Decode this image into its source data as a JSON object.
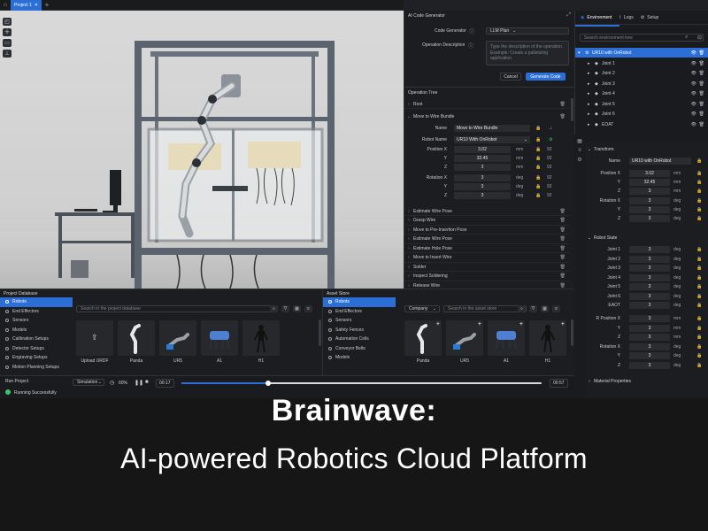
{
  "tabbar": {
    "tab_label": "Project 1",
    "close": "✕",
    "add": "+"
  },
  "ai_code": {
    "title": "AI Code Generator",
    "code_generator_label": "Code Generator",
    "code_generator_value": "LLM Plan",
    "operation_desc_label": "Operation Description",
    "operation_desc_placeholder": "Type the description of the operation. Example: Create a palletizing application",
    "cancel": "Cancel",
    "generate": "Generate Code"
  },
  "op_tree": {
    "title": "Operation Tree",
    "root": "Root",
    "group": "Move to Wire Bundle",
    "fields": {
      "name_label": "Name",
      "name_value": "Move to Wire Bundle",
      "robot_label": "Robot Name",
      "robot_value": "UR10 With OnRobot",
      "px_label": "Position X",
      "px": "3.02",
      "py_label": "Y",
      "py": "32.45",
      "pz_label": "Z",
      "pz": "3",
      "rx_label": "Rotation X",
      "rx": "3",
      "ry_label": "Y",
      "ry": "3",
      "rz_label": "Z",
      "rz": "3",
      "mm": "mm",
      "deg": "deg"
    },
    "ops": [
      "Estimate Wire Pose",
      "Grasp Wire",
      "Move to Pre-Insertion Pose",
      "Estimate Wire Pose",
      "Estimate Hole Pose",
      "Move to Insert Wire",
      "Solder",
      "Inspect Soldering",
      "Release Wire"
    ]
  },
  "env": {
    "tabs": [
      "Environment",
      "Logs",
      "Setup"
    ],
    "search_placeholder": "Search environment tree",
    "root": "UR10 with OnRobot",
    "joints": [
      "Joint 1",
      "Joint 2",
      "Joint 3",
      "Joint 4",
      "Joint 5",
      "Joint 6",
      "EOAT"
    ]
  },
  "props": {
    "transform": "Transform",
    "name_label": "Name",
    "name_value": "UR10 with OnRobot",
    "px_label": "Position X",
    "px": "3.02",
    "py_label": "Y",
    "py": "32.45",
    "pz_label": "Z",
    "pz": "3",
    "rx_label": "Rotation X",
    "rx": "3",
    "ry_label": "Y",
    "ry": "3",
    "rz_label": "Z",
    "rz": "3",
    "robot_state": "Robot State",
    "joint_labels": [
      "Joint 1",
      "Joint 2",
      "Joint 3",
      "Joint 4",
      "Joint 5",
      "Joint 6",
      "EAOT"
    ],
    "joint_values": [
      "3",
      "3",
      "3",
      "3",
      "3",
      "3",
      "3"
    ],
    "r_pos_label": "R Position X",
    "r_px": "3",
    "r_py_label": "Y",
    "r_py": "3",
    "r_pz_label": "Z",
    "r_pz": "3",
    "r_rx_label": "Rotation X",
    "r_rx": "3",
    "r_ry_label": "Y",
    "r_ry": "3",
    "r_rz_label": "Z",
    "r_rz": "3",
    "material": "Material Properties",
    "mm": "mm",
    "deg": "deg"
  },
  "project_db": {
    "title": "Project Database",
    "items": [
      "Robots",
      "End Effectors",
      "Sensors",
      "Models",
      "Calibration Setups",
      "Detector Setups",
      "Engraving Setups",
      "Motion Planning Setups"
    ],
    "search_placeholder": "Search in the project database",
    "cards": [
      "Upload URDF",
      "Panda",
      "UR5",
      "A1",
      "H1"
    ]
  },
  "asset_store": {
    "title": "Asset Store",
    "items": [
      "Robots",
      "End Effectors",
      "Sensors",
      "Safety Fences",
      "Automation Cells",
      "Conveyor Belts",
      "Models"
    ],
    "company": "Company",
    "search_placeholder": "Search in the asset store",
    "cards": [
      "Panda",
      "UR5",
      "A1",
      "H1"
    ]
  },
  "run": {
    "title": "Run Project",
    "mode": "Simulation",
    "speed": "60%",
    "elapsed": "00:17",
    "total": "00:57",
    "progress": 0.24,
    "status": "Running Successfully"
  },
  "caption": {
    "title": "Brainwave:",
    "subtitle": "AI-powered Robotics Cloud Platform"
  },
  "colors": {
    "accent": "#2b6fd6",
    "status_ok": "#3ec46d"
  }
}
